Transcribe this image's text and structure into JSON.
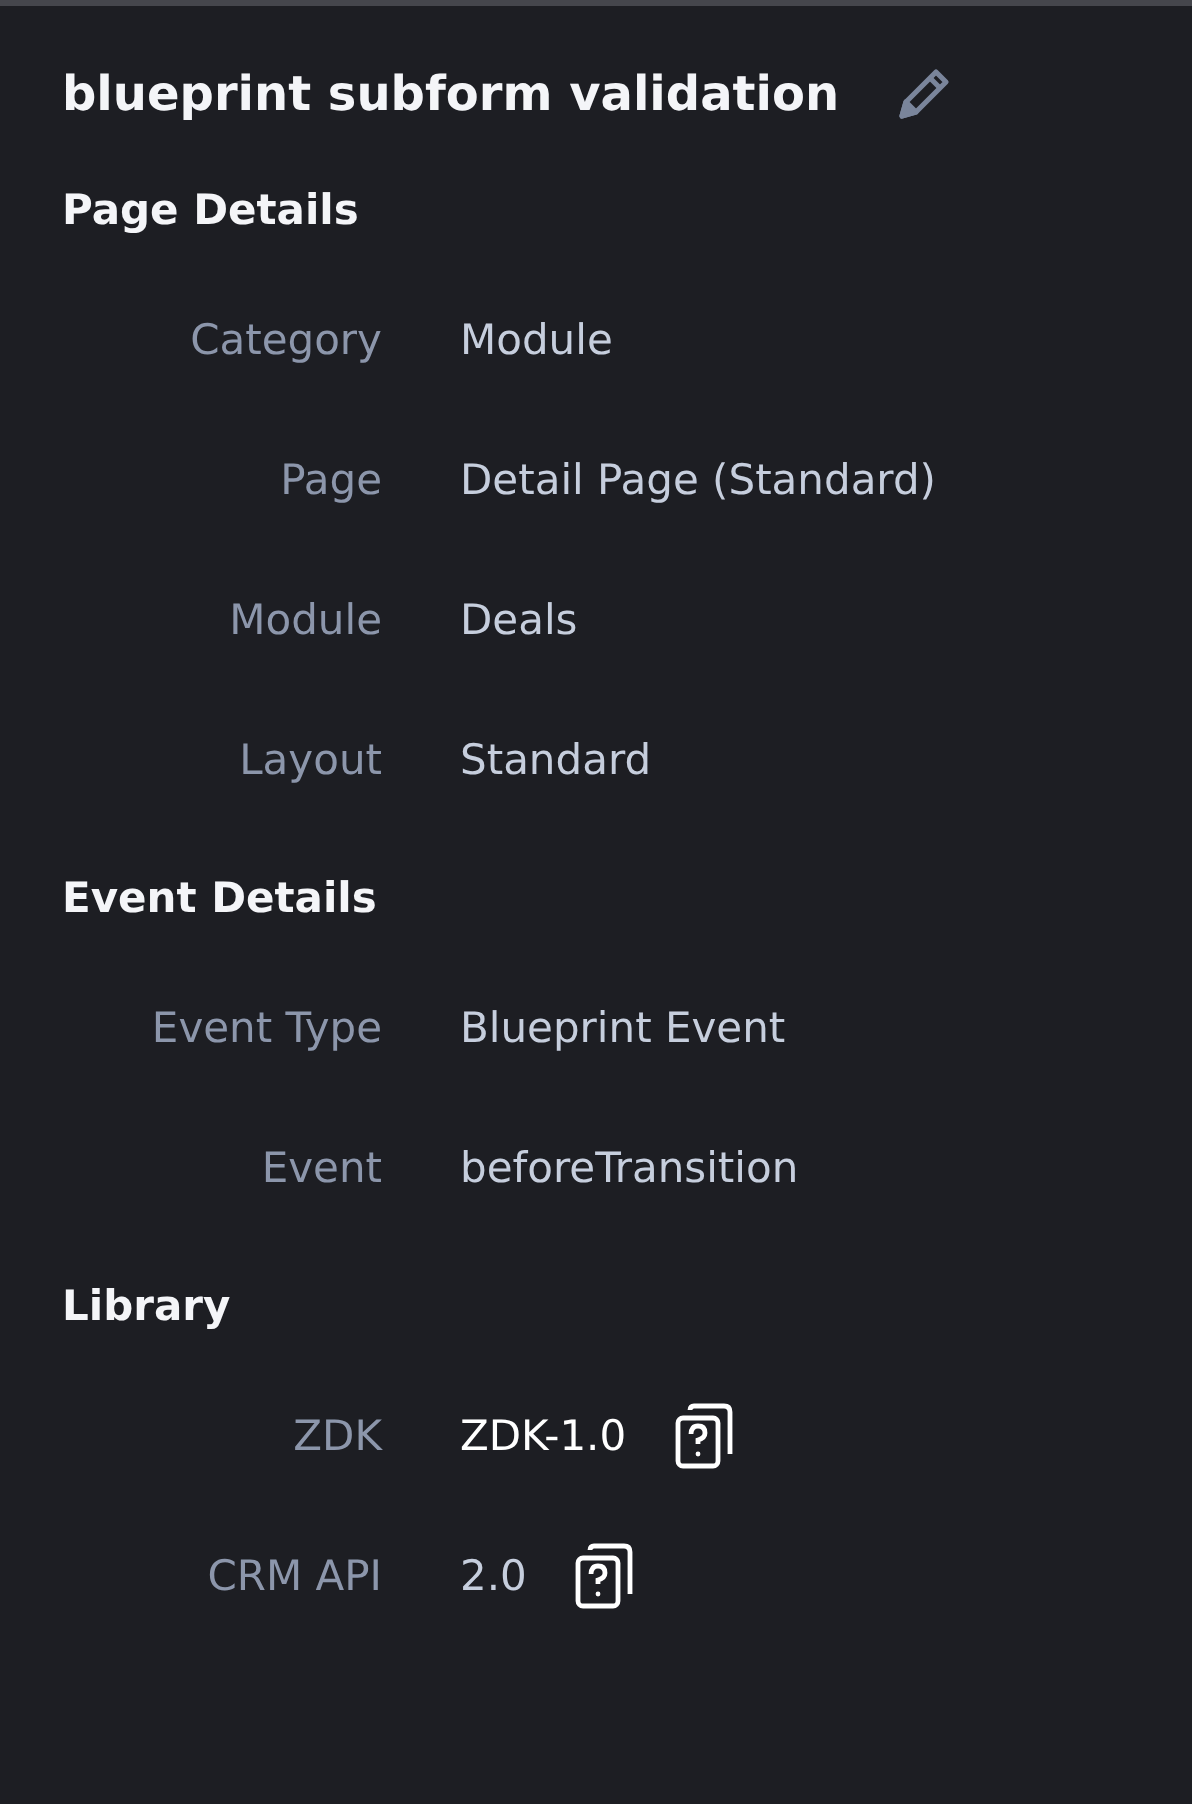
{
  "title": "blueprint subform validation",
  "sections": [
    {
      "heading": "Page Details",
      "rows": [
        {
          "label": "Category",
          "value": "Module",
          "highlighted": false,
          "help": false
        },
        {
          "label": "Page",
          "value": "Detail Page (Standard)",
          "highlighted": false,
          "help": false
        },
        {
          "label": "Module",
          "value": "Deals",
          "highlighted": false,
          "help": false
        },
        {
          "label": "Layout",
          "value": "Standard",
          "highlighted": false,
          "help": false
        }
      ]
    },
    {
      "heading": "Event Details",
      "rows": [
        {
          "label": "Event Type",
          "value": "Blueprint Event",
          "highlighted": false,
          "help": false
        },
        {
          "label": "Event",
          "value": "beforeTransition",
          "highlighted": false,
          "help": false
        }
      ]
    },
    {
      "heading": "Library",
      "rows": [
        {
          "label": "ZDK",
          "value": "ZDK-1.0",
          "highlighted": true,
          "help": true
        },
        {
          "label": "CRM API",
          "value": "2.0",
          "highlighted": false,
          "help": true
        }
      ]
    }
  ]
}
